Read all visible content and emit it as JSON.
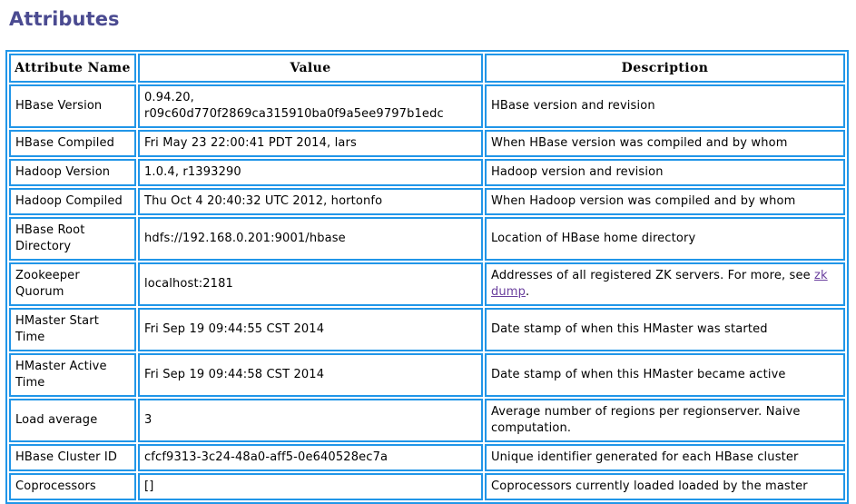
{
  "page": {
    "title": "Attributes",
    "title_color": "#4b4b91",
    "table_border_color": "#2196e8",
    "link_color": "#6a3f9e"
  },
  "table": {
    "columns": [
      {
        "key": "name",
        "label": "Attribute Name"
      },
      {
        "key": "value",
        "label": "Value"
      },
      {
        "key": "description",
        "label": "Description"
      }
    ],
    "rows": [
      {
        "name": "HBase Version",
        "value": "0.94.20, r09c60d770f2869ca315910ba0f9a5ee9797b1edc",
        "description": "HBase version and revision",
        "height": "tall"
      },
      {
        "name": "HBase Compiled",
        "value": "Fri May 23 22:00:41 PDT 2014, lars",
        "description": "When HBase version was compiled and by whom",
        "height": "short"
      },
      {
        "name": "Hadoop Version",
        "value": "1.0.4, r1393290",
        "description": "Hadoop version and revision",
        "height": "short"
      },
      {
        "name": "Hadoop Compiled",
        "value": "Thu Oct 4 20:40:32 UTC 2012, hortonfo",
        "description": "When Hadoop version was compiled and by whom",
        "height": "short"
      },
      {
        "name": "HBase Root Directory",
        "value": "hdfs://192.168.0.201:9001/hbase",
        "description": "Location of HBase home directory",
        "height": "tall"
      },
      {
        "name": "Zookeeper Quorum",
        "value": "localhost:2181",
        "description_prefix": "Addresses of all registered ZK servers. For more, see ",
        "description_link": "zk dump",
        "description_suffix": ".",
        "height": "tall"
      },
      {
        "name": "HMaster Start Time",
        "value": "Fri Sep 19 09:44:55 CST 2014",
        "description": "Date stamp of when this HMaster was started",
        "height": "tall"
      },
      {
        "name": "HMaster Active Time",
        "value": "Fri Sep 19 09:44:58 CST 2014",
        "description": "Date stamp of when this HMaster became active",
        "height": "tall"
      },
      {
        "name": "Load average",
        "value": "3",
        "description": "Average number of regions per regionserver. Naive computation.",
        "height": "tall"
      },
      {
        "name": "HBase Cluster ID",
        "value": "cfcf9313-3c24-48a0-aff5-0e640528ec7a",
        "description": "Unique identifier generated for each HBase cluster",
        "height": "short"
      },
      {
        "name": "Coprocessors",
        "value": "[]",
        "description": "Coprocessors currently loaded loaded by the master",
        "height": "short"
      }
    ]
  }
}
